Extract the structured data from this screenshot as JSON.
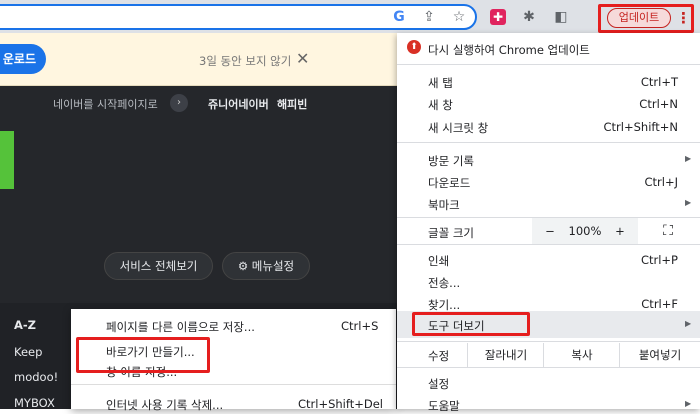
{
  "toolbar": {
    "update_label": "업데이트",
    "menu_glyph": "⋮"
  },
  "banner": {
    "download_label": "운로드",
    "hide_text": "3일 동안 보지 않기",
    "close_glyph": "✕"
  },
  "naver": {
    "startpage_text": "네이버를 시작페이지로",
    "arrow_glyph": "›",
    "junior": "쥬니어네이버",
    "happybean": "해피빈",
    "service_all": "서비스 전체보기",
    "menu_setting": "⚙ 메뉴설정",
    "side_items": [
      "A-Z",
      "Keep",
      "modoo!",
      "MYBOX"
    ]
  },
  "submenu": {
    "items": [
      {
        "label": "페이지를 다른 이름으로 저장...",
        "shortcut": "Ctrl+S"
      },
      {
        "label": "바로가기 만들기...",
        "shortcut": ""
      },
      {
        "label": "창 이름 지정...",
        "shortcut": ""
      },
      {
        "label": "인터넷 사용 기록 삭제...",
        "shortcut": "Ctrl+Shift+Del"
      }
    ]
  },
  "menu": {
    "relaunch": "다시 실행하여 Chrome 업데이트",
    "new_tab": "새 탭",
    "new_tab_sc": "Ctrl+T",
    "new_window": "새 창",
    "new_window_sc": "Ctrl+N",
    "incognito": "새 시크릿 창",
    "incognito_sc": "Ctrl+Shift+N",
    "history": "방문 기록",
    "downloads": "다운로드",
    "downloads_sc": "Ctrl+J",
    "bookmarks": "북마크",
    "font_size": "글꼴 크기",
    "zoom_minus": "−",
    "zoom_value": "100%",
    "zoom_plus": "+",
    "fullscreen": "⛶",
    "print": "인쇄",
    "print_sc": "Ctrl+P",
    "cast": "전송...",
    "find": "찾기...",
    "find_sc": "Ctrl+F",
    "more_tools": "도구 더보기",
    "edit": "수정",
    "cut": "잘라내기",
    "copy": "복사",
    "paste": "붙여넣기",
    "settings": "설정",
    "help": "도움말",
    "submenu_arrow": "▶"
  }
}
